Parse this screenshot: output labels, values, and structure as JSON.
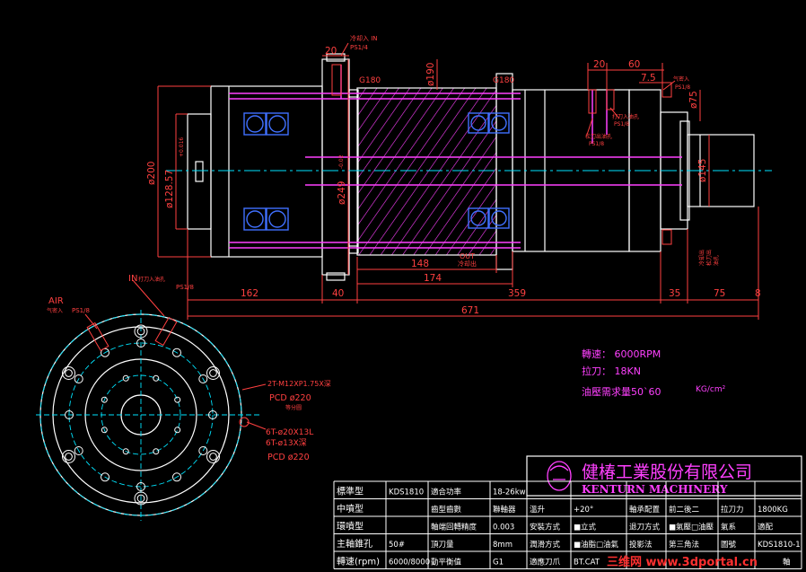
{
  "colors": {
    "background": "#000000",
    "outline": "#ffffff",
    "dimension": "#ff4040",
    "centerline": "#00e5ff",
    "magenta": "#ff40ff",
    "bearing": "#4070ff",
    "spec_text": "#ff40ff",
    "title_text": "#ffffff",
    "watermark": "#ff3030"
  },
  "dimensions": {
    "d_200": "ø200",
    "d_128": "ø128.57",
    "d_128_tol": "+0.016",
    "d_249": "ø249",
    "d_249_tol": "-0.02",
    "d_190": "ø190",
    "d_145": "ø145",
    "d_75": "ø75",
    "top_20": "20",
    "top_20b": "20",
    "top_60": "60",
    "top_7_5": "7.5",
    "len_162": "162",
    "len_40": "40",
    "len_148": "148",
    "len_174": "174",
    "len_359": "359",
    "len_35": "35",
    "len_75": "75",
    "len_8": "8",
    "len_671": "671"
  },
  "labels": {
    "g180_left": "G180",
    "g180_right": "G180",
    "coolant_in_top": "冷却入 IN",
    "ps14_top": "PS1/4",
    "ps18_right_a": "PS1/8",
    "ps18_right_b": "PS1/8",
    "ps18_right_c": "PS1/8",
    "out_label": "OUT",
    "out_sub": "冷却出",
    "air_label": "AIR",
    "air_sub": "气密入",
    "air_ps": "PS1/8",
    "in_label": "IN",
    "in_sub": "打刀入油孔",
    "in_ps": "PS1/8",
    "thread_spec": "2T-M12XP1.75X深",
    "pcd1": "PCD ø220",
    "pcd1_sub": "等分圆",
    "hole_spec1": "6T-ø20X13L",
    "hole_spec2": "6T-ø13X深",
    "pcd2": "PCD ø220",
    "side_note_a": "打刀入油孔",
    "side_note_b": "松刀出油孔",
    "side_note_c": "气密入",
    "side_note_d": "冷却出",
    "side_note_e": "松刀出",
    "side_note_f": "油孔"
  },
  "specs": {
    "speed": "轉速： 6000RPM",
    "force": "拉刀： 18KN",
    "pressure": "油壓需求量50`60",
    "pressure_unit": "KG/cm²"
  },
  "company": {
    "name_cn": "健椿工業股份有限公司",
    "name_en": "KENTURN  MACHINERY"
  },
  "table": {
    "rows": [
      [
        "標準型",
        "KDS1810",
        "適合功率",
        "18-26kw",
        "",
        "",
        "",
        ""
      ],
      [
        "中噴型",
        "",
        "齒型齒數",
        "聯軸器",
        "溫升",
        "+20°",
        "軸承配置",
        "前二後二",
        "拉刀力",
        "1800KG"
      ],
      [
        "環噴型",
        "",
        "軸端回轉精度",
        "0.003",
        "安裝方式",
        "■立式",
        "退刀方式",
        "■氣壓□油壓",
        "氣系",
        "適配"
      ],
      [
        "主軸錐孔",
        "50#",
        "頂刀量",
        "8mm",
        "潤滑方式",
        "■油脂□油氣",
        "投影法",
        "第三角法",
        "圖號",
        "KDS1810-1"
      ],
      [
        "轉速(rpm)",
        "6000/8000",
        "動平衡值",
        "G1",
        "適應刀爪",
        "BT.CAT",
        "",
        "",
        "",
        ""
      ]
    ],
    "last_right": "軸"
  },
  "watermark": "三维网 www.3dportal.cn"
}
